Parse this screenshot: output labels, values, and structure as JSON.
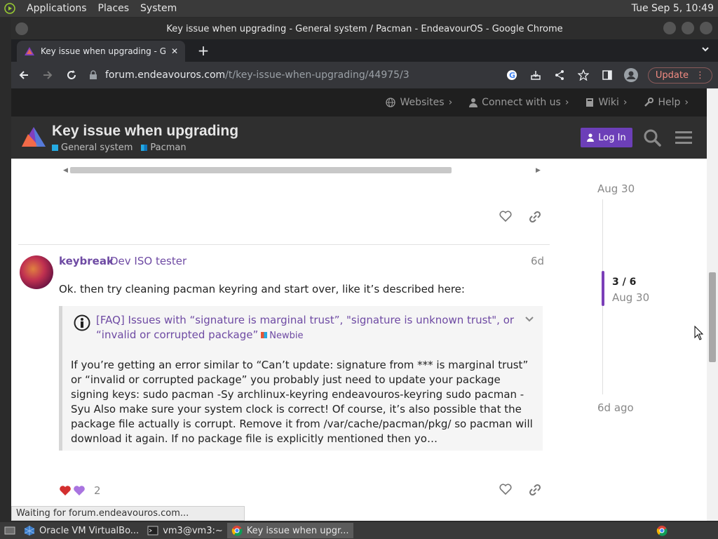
{
  "system": {
    "menu": [
      "Applications",
      "Places",
      "System"
    ],
    "clock": "Tue Sep  5, 10:49"
  },
  "window": {
    "title": "Key issue when upgrading - General system / Pacman - EndeavourOS - Google Chrome"
  },
  "browser": {
    "tab_title": "Key issue when upgrading - General system / Pacman - EndeavourOS",
    "url_host": "forum.endeavouros.com",
    "url_path": "/t/key-issue-when-upgrading/44975/3",
    "update_label": "Update",
    "status": "Waiting for forum.endeavouros.com..."
  },
  "site": {
    "topnav": [
      "Websites",
      "Connect with us",
      "Wiki",
      "Help"
    ],
    "topic_title": "Key issue when upgrading",
    "categories": [
      {
        "label": "General system",
        "color": "#25AAE2"
      },
      {
        "label": "Pacman",
        "color": "#0E76BD"
      }
    ],
    "login": "Log In"
  },
  "post": {
    "username": "keybreak",
    "user_title": "Dev ISO tester",
    "date": "6d",
    "text": "Ok. then try cleaning pacman keyring and start over, like it’s described here:",
    "quote": {
      "title": "[FAQ] Issues with “signature is marginal trust”, \"signature is unknown trust\", or “invalid or corrupted package”",
      "badge": "Newbie",
      "body": "If you’re getting an error similar to “Can’t update: signature from *** is marginal trust” or “invalid or corrupted package” you probably just need to update your package signing keys: sudo pacman -Sy archlinux-keyring endeavouros-keyring sudo pacman -Syu Also make sure your system clock is correct! Of course, it’s also possible that the package file actually is corrupt. Remove it from /var/cache/pacman/pkg/ so pacman will download it again. If no package file is explicitly mentioned then yo…"
    },
    "reaction_count": "2"
  },
  "timeline": {
    "top_date": "Aug 30",
    "position": "3 / 6",
    "position_date": "Aug 30",
    "bottom_date": "6d ago"
  },
  "taskbar": [
    {
      "label": "Oracle VM VirtualBo..."
    },
    {
      "label": "vm3@vm3:~"
    },
    {
      "label": "Key issue when upgr..."
    }
  ],
  "colors": {
    "accent": "#6c3fb8",
    "link": "#6e4aa3"
  }
}
